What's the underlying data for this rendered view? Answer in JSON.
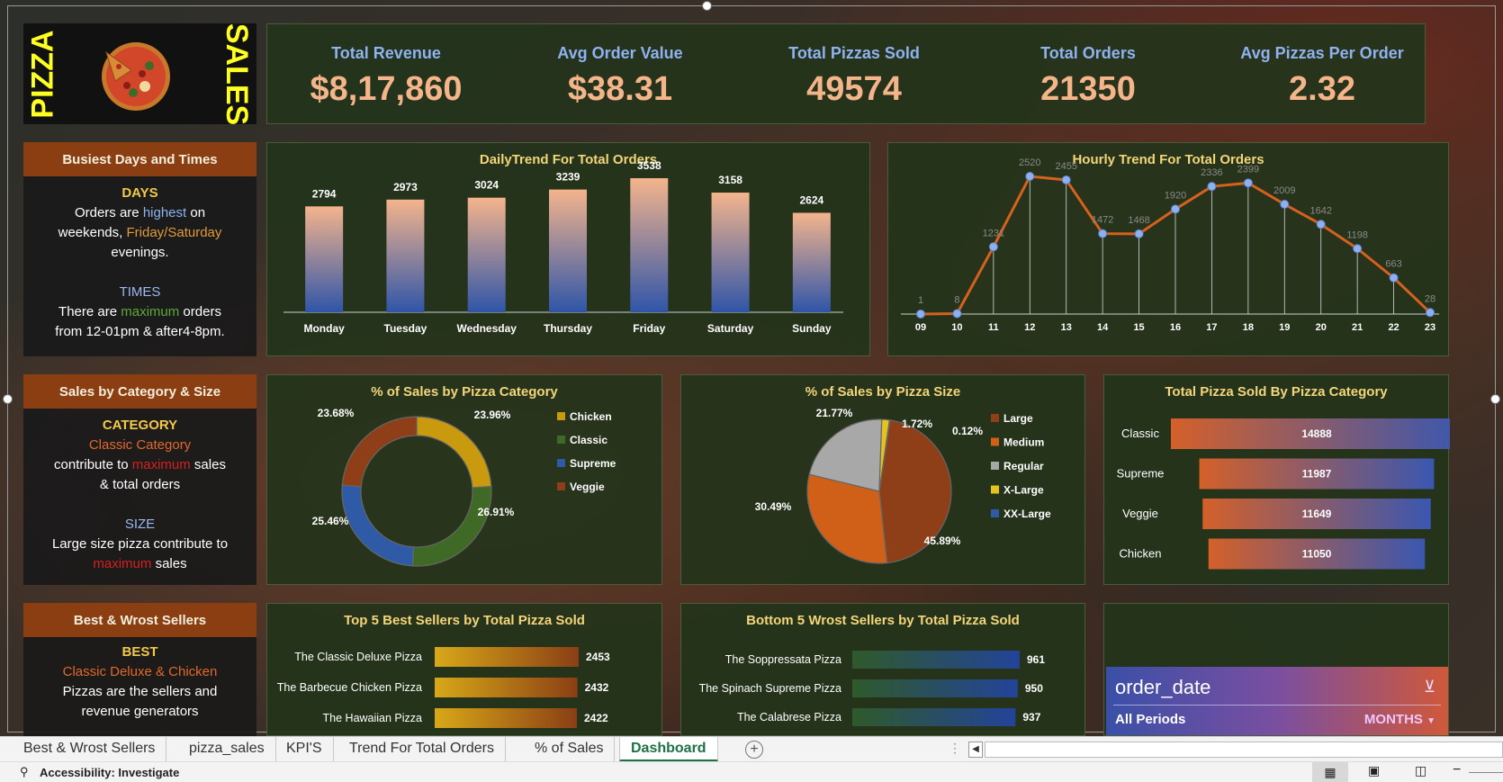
{
  "brand": {
    "left_word": "PIZZA",
    "right_word": "SALES"
  },
  "kpis": [
    {
      "label": "Total Revenue",
      "value": "$8,17,860"
    },
    {
      "label": "Avg Order Value",
      "value": "$38.31"
    },
    {
      "label": "Total Pizzas Sold",
      "value": "49574"
    },
    {
      "label": "Total Orders",
      "value": "21350"
    },
    {
      "label": "Avg Pizzas Per Order",
      "value": "2.32"
    }
  ],
  "busiest": {
    "title": "Busiest Days and Times",
    "days_head": "DAYS",
    "days_l1a": "Orders are ",
    "days_l1b": "highest",
    "days_l1c": " on",
    "days_l2a": "weekends, ",
    "days_l2b": "Friday/Saturday",
    "days_l3": "evenings.",
    "times_head": "TIMES",
    "times_l1a": "There are ",
    "times_l1b": "maximum",
    "times_l1c": " orders",
    "times_l2": "from 12-01pm & after4-8pm."
  },
  "category_size": {
    "title": "Sales by Category & Size",
    "cat_head": "CATEGORY",
    "cat_l1": "Classic Category",
    "cat_l2a": "contribute to ",
    "cat_l2b": "maximum",
    "cat_l2c": " sales",
    "cat_l3": "& total orders",
    "size_head": "SIZE",
    "size_l1": "Large size pizza contribute to",
    "size_l2a": "maximum",
    "size_l2b": " sales"
  },
  "best_worst": {
    "title": "Best & Wrost Sellers",
    "best_head": "BEST",
    "best_l1": "Classic Deluxe & Chicken",
    "best_l2": "Pizzas are the sellers and",
    "best_l3": "revenue generators"
  },
  "daily_trend": {
    "title": "DailyTrend For Total Orders",
    "chart_data": {
      "type": "bar",
      "categories": [
        "Monday",
        "Tuesday",
        "Wednesday",
        "Thursday",
        "Friday",
        "Saturday",
        "Sunday"
      ],
      "values": [
        2794,
        2973,
        3024,
        3239,
        3538,
        3158,
        2624
      ],
      "ylim": [
        0,
        3800
      ]
    }
  },
  "hourly_trend": {
    "title": "Hourly Trend For Total Orders",
    "chart_data": {
      "type": "line",
      "x": [
        "09",
        "10",
        "11",
        "12",
        "13",
        "14",
        "15",
        "16",
        "17",
        "18",
        "19",
        "20",
        "21",
        "22",
        "23"
      ],
      "values": [
        1,
        8,
        1231,
        2520,
        2455,
        1472,
        1468,
        1920,
        2336,
        2399,
        2009,
        1642,
        1198,
        663,
        28
      ],
      "ylim": [
        0,
        2800
      ]
    }
  },
  "category_pct": {
    "title": "% of Sales by Pizza Category",
    "chart_data": {
      "type": "pie",
      "donut": true,
      "labels": [
        "Chicken",
        "Classic",
        "Supreme",
        "Veggie"
      ],
      "values": [
        23.96,
        26.91,
        25.46,
        23.68
      ],
      "value_labels": [
        "23.96%",
        "26.91%",
        "25.46%",
        "23.68%"
      ],
      "colors": [
        "#c99a0e",
        "#3f6a25",
        "#2f5aa5",
        "#8e3f18"
      ]
    }
  },
  "size_pct": {
    "title": "% of Sales by Pizza Size",
    "chart_data": {
      "type": "pie",
      "labels": [
        "Large",
        "Medium",
        "Regular",
        "X-Large",
        "XX-Large"
      ],
      "values": [
        45.89,
        30.49,
        21.77,
        1.72,
        0.12
      ],
      "value_labels": [
        "45.89%",
        "30.49%",
        "21.77%",
        "1.72%",
        "0.12%"
      ],
      "colors": [
        "#8e3f18",
        "#d05f18",
        "#a8a8a8",
        "#e5c21c",
        "#2f5aa5"
      ]
    }
  },
  "category_sold": {
    "title": "Total Pizza Sold By Pizza Category",
    "chart_data": {
      "type": "bar",
      "categories": [
        "Classic",
        "Supreme",
        "Veggie",
        "Chicken"
      ],
      "values": [
        14888,
        11987,
        11649,
        11050
      ]
    }
  },
  "top5": {
    "title": "Top 5 Best Sellers by Total Pizza Sold",
    "chart_data": {
      "type": "bar",
      "categories": [
        "The Classic Deluxe Pizza",
        "The Barbecue Chicken Pizza",
        "The Hawaiian Pizza"
      ],
      "values": [
        2453,
        2432,
        2422
      ]
    }
  },
  "bottom5": {
    "title": "Bottom 5 Wrost Sellers by Total Pizza Sold",
    "chart_data": {
      "type": "bar",
      "categories": [
        "The Soppressata Pizza",
        "The Spinach Supreme Pizza",
        "The Calabrese Pizza"
      ],
      "values": [
        961,
        950,
        937
      ]
    }
  },
  "slicer": {
    "title": "order_date",
    "period": "All Periods",
    "unit": "MONTHS"
  },
  "tabs": [
    "Best & Wrost Sellers",
    "pizza_sales",
    "KPI'S",
    "Trend For Total Orders",
    "% of Sales",
    "Dashboard"
  ],
  "status": {
    "accessibility": "Accessibility: Investigate"
  },
  "colors": {
    "panel": "#23341b",
    "accent_brown": "#8b3e12",
    "kpi_value": "#f5b58a",
    "kpi_label": "#8fb2f0",
    "title_yellow": "#f3d57a"
  }
}
